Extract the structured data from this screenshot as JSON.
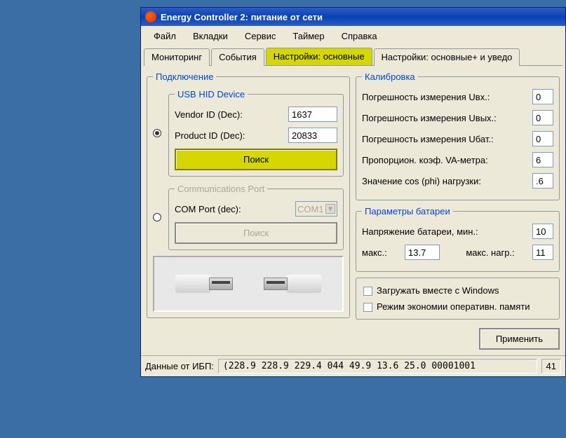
{
  "titlebar": {
    "title": "Energy Controller 2: питание от сети"
  },
  "menu": {
    "file": "Файл",
    "tabs": "Вкладки",
    "service": "Сервис",
    "timer": "Таймер",
    "help": "Справка"
  },
  "tabs": {
    "monitoring": "Мониторинг",
    "events": "События",
    "settings_main": "Настройки: основные",
    "settings_ext": "Настройки: основные+ и уведо"
  },
  "connection": {
    "legend": "Подключение",
    "usb": {
      "legend": "USB HID Device",
      "vendor_label": "Vendor ID (Dec):",
      "vendor_value": "1637",
      "product_label": "Product ID (Dec):",
      "product_value": "20833",
      "search_btn": "Поиск"
    },
    "com": {
      "legend": "Communications Port",
      "port_label": "COM Port (dec):",
      "port_value": "COM1",
      "search_btn": "Поиск"
    }
  },
  "calibration": {
    "legend": "Калибровка",
    "uin_label": "Погрешность измерения Uвх.:",
    "uin_value": "0",
    "uout_label": "Погрешность измерения Uвых.:",
    "uout_value": "0",
    "ubat_label": "Погрешность измерения Uбат.:",
    "ubat_value": "0",
    "va_label": "Пропорцион. коэф. VA-метра:",
    "va_value": "6",
    "cos_label": "Значение cos (phi) нагрузки:",
    "cos_value": ".6"
  },
  "battery": {
    "legend": "Параметры батареи",
    "vmin_label": "Напряжение батареи, мин.:",
    "vmin_value": "10",
    "max_label": "макс.:",
    "max_value": "13.7",
    "maxload_label": "макс. нагр.:",
    "maxload_value": "11"
  },
  "options": {
    "autostart": "Загружать вместе с Windows",
    "lowmem": "Режим экономии оперативн. памяти"
  },
  "apply_btn": "Применить",
  "status": {
    "label": "Данные от ИБП:",
    "data": "(228.9 228.9 229.4 044 49.9 13.6 25.0 00001001",
    "count": "41"
  }
}
